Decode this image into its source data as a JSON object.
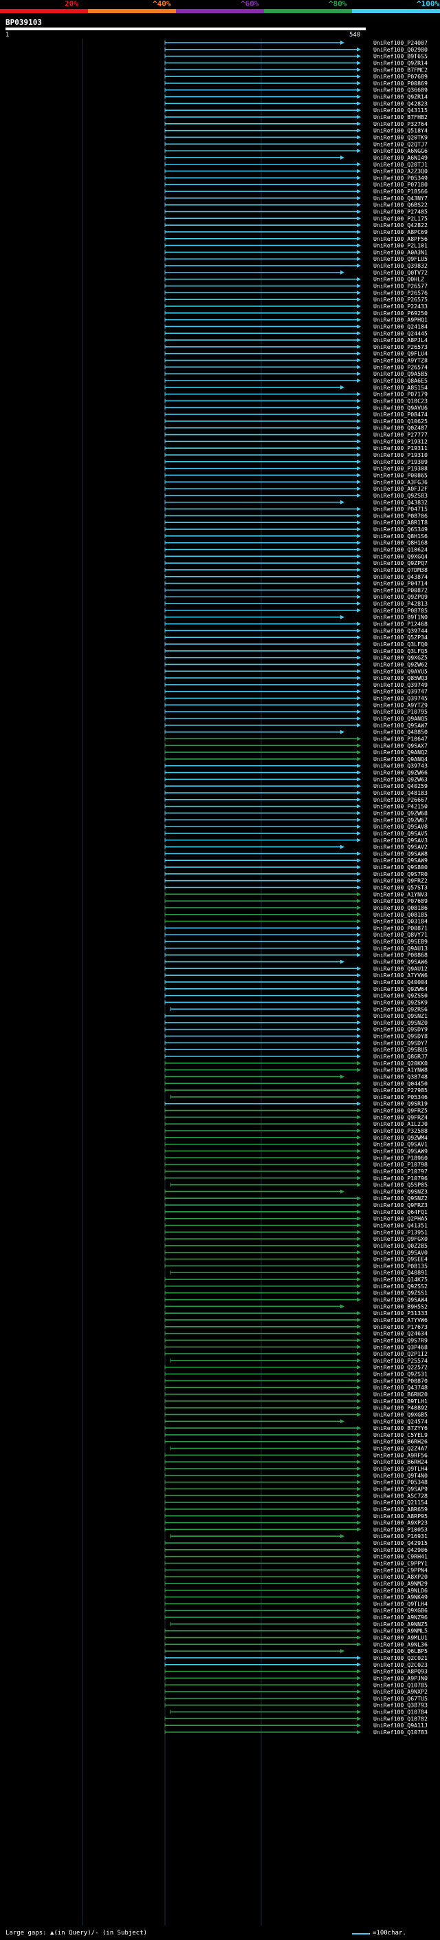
{
  "legend": {
    "labels": [
      "20%",
      "^40%",
      "^60%",
      "^80%",
      "^100%"
    ],
    "colors": [
      "#e8141c",
      "#f47a20",
      "#8a2cb0",
      "#2aa04a",
      "#44ccee"
    ]
  },
  "query": {
    "id": "BP039103",
    "start": "1",
    "end": "540"
  },
  "footer": {
    "large_gaps": "Large gaps: ▲(in Query)/- (in Subject)",
    "scale": "=100char."
  },
  "hits": [
    {
      "label": "UniRef100_P24007",
      "c": "#44ccee"
    },
    {
      "label": "UniRef100_Q02980",
      "c": "#44ccee"
    },
    {
      "label": "UniRef100_B9T6S5",
      "c": "#44ccee"
    },
    {
      "label": "UniRef100_Q9ZR14",
      "c": "#44ccee"
    },
    {
      "label": "UniRef100_B7FMC2",
      "c": "#44ccee"
    },
    {
      "label": "UniRef100_P07689",
      "c": "#44ccee"
    },
    {
      "label": "UniRef100_P00869",
      "c": "#44ccee"
    },
    {
      "label": "UniRef100_Q36689",
      "c": "#44ccee"
    },
    {
      "label": "UniRef100_Q9ZR14",
      "c": "#44ccee"
    },
    {
      "label": "UniRef100_Q42823",
      "c": "#44ccee"
    },
    {
      "label": "UniRef100_Q43115",
      "c": "#44ccee"
    },
    {
      "label": "UniRef100_B7FHB2",
      "c": "#44ccee"
    },
    {
      "label": "UniRef100_P32764",
      "c": "#44ccee"
    },
    {
      "label": "UniRef100_Q518Y4",
      "c": "#44ccee"
    },
    {
      "label": "UniRef100_Q20TK9",
      "c": "#44ccee"
    },
    {
      "label": "UniRef100_Q2QTJ7",
      "c": "#44ccee"
    },
    {
      "label": "UniRef100_A6NGG6",
      "c": "#44ccee"
    },
    {
      "label": "UniRef100_A6NI49",
      "c": "#44ccee"
    },
    {
      "label": "UniRef100_Q20TJ1",
      "c": "#44ccee"
    },
    {
      "label": "UniRef100_A2Z3Q0",
      "c": "#44ccee"
    },
    {
      "label": "UniRef100_P05349",
      "c": "#44ccee"
    },
    {
      "label": "UniRef100_P07180",
      "c": "#44ccee"
    },
    {
      "label": "UniRef100_P18566",
      "c": "#44ccee"
    },
    {
      "label": "UniRef100_Q43NY7",
      "c": "#44ccee"
    },
    {
      "label": "UniRef100_Q6BS22",
      "c": "#44ccee"
    },
    {
      "label": "UniRef100_P27485",
      "c": "#44ccee"
    },
    {
      "label": "UniRef100_P2L175",
      "c": "#44ccee"
    },
    {
      "label": "UniRef100_Q42822",
      "c": "#44ccee"
    },
    {
      "label": "UniRef100_A8PC69",
      "c": "#44ccee"
    },
    {
      "label": "UniRef100_A8PF56",
      "c": "#44ccee"
    },
    {
      "label": "UniRef100_P2L101",
      "c": "#44ccee"
    },
    {
      "label": "UniRef100_A0A3N1",
      "c": "#44ccee"
    },
    {
      "label": "UniRef100_Q9FLU5",
      "c": "#44ccee"
    },
    {
      "label": "UniRef100_Q39832",
      "c": "#44ccee"
    },
    {
      "label": "UniRef100_Q0TV72",
      "c": "#44ccee"
    },
    {
      "label": "UniRef100_Q0HLZ",
      "c": "#44ccee"
    },
    {
      "label": "UniRef100_P26577",
      "c": "#44ccee"
    },
    {
      "label": "UniRef100_P26576",
      "c": "#44ccee"
    },
    {
      "label": "UniRef100_P26575",
      "c": "#44ccee"
    },
    {
      "label": "UniRef100_P22433",
      "c": "#44ccee"
    },
    {
      "label": "UniRef100_P69250",
      "c": "#44ccee"
    },
    {
      "label": "UniRef100_A9PHQ1",
      "c": "#44ccee"
    },
    {
      "label": "UniRef100_Q24184",
      "c": "#44ccee"
    },
    {
      "label": "UniRef100_Q24445",
      "c": "#44ccee"
    },
    {
      "label": "UniRef100_A8PJL4",
      "c": "#44ccee"
    },
    {
      "label": "UniRef100_P26573",
      "c": "#44ccee"
    },
    {
      "label": "UniRef100_Q9FLU4",
      "c": "#44ccee"
    },
    {
      "label": "UniRef100_A9YTZ8",
      "c": "#44ccee"
    },
    {
      "label": "UniRef100_P26574",
      "c": "#44ccee"
    },
    {
      "label": "UniRef100_Q9A5B5",
      "c": "#44ccee"
    },
    {
      "label": "UniRef100_Q8A6E5",
      "c": "#44ccee"
    },
    {
      "label": "UniRef100_A8S1S4",
      "c": "#44ccee"
    },
    {
      "label": "UniRef100_P07179",
      "c": "#44ccee"
    },
    {
      "label": "UniRef100_Q10C23",
      "c": "#44ccee"
    },
    {
      "label": "UniRef100_Q9AVU6",
      "c": "#44ccee"
    },
    {
      "label": "UniRef100_P08474",
      "c": "#44ccee"
    },
    {
      "label": "UniRef100_Q10625",
      "c": "#44ccee"
    },
    {
      "label": "UniRef100_Q0Z487",
      "c": "#44ccee"
    },
    {
      "label": "UniRef100_P27777",
      "c": "#44ccee"
    },
    {
      "label": "UniRef100_P19312",
      "c": "#44ccee"
    },
    {
      "label": "UniRef100_P19311",
      "c": "#44ccee"
    },
    {
      "label": "UniRef100_P19310",
      "c": "#44ccee"
    },
    {
      "label": "UniRef100_P19309",
      "c": "#44ccee"
    },
    {
      "label": "UniRef100_P19308",
      "c": "#44ccee"
    },
    {
      "label": "UniRef100_P00865",
      "c": "#44ccee"
    },
    {
      "label": "UniRef100_A3FGJ6",
      "c": "#44ccee"
    },
    {
      "label": "UniRef100_A0FJ2F",
      "c": "#44ccee"
    },
    {
      "label": "UniRef100_Q9ZS83",
      "c": "#44ccee"
    },
    {
      "label": "UniRef100_Q43832",
      "c": "#44ccee"
    },
    {
      "label": "UniRef100_P04715",
      "c": "#44ccee"
    },
    {
      "label": "UniRef100_P08706",
      "c": "#44ccee"
    },
    {
      "label": "UniRef100_A8R1T8",
      "c": "#44ccee"
    },
    {
      "label": "UniRef100_Q65349",
      "c": "#44ccee"
    },
    {
      "label": "UniRef100_Q8H1S6",
      "c": "#44ccee"
    },
    {
      "label": "UniRef100_Q8H168",
      "c": "#44ccee"
    },
    {
      "label": "UniRef100_Q10624",
      "c": "#44ccee"
    },
    {
      "label": "UniRef100_Q9XGQ4",
      "c": "#44ccee"
    },
    {
      "label": "UniRef100_Q9ZPQ7",
      "c": "#44ccee"
    },
    {
      "label": "UniRef100_Q7DM38",
      "c": "#44ccee"
    },
    {
      "label": "UniRef100_Q43874",
      "c": "#44ccee"
    },
    {
      "label": "UniRef100_P04714",
      "c": "#44ccee"
    },
    {
      "label": "UniRef100_P00872",
      "c": "#44ccee"
    },
    {
      "label": "UniRef100_Q9ZPQ9",
      "c": "#44ccee"
    },
    {
      "label": "UniRef100_P42813",
      "c": "#44ccee"
    },
    {
      "label": "UniRef100_P08705",
      "c": "#44ccee"
    },
    {
      "label": "UniRef100_B9T1N0",
      "c": "#44ccee"
    },
    {
      "label": "UniRef100_P12468",
      "c": "#44ccee"
    },
    {
      "label": "UniRef100_Q39744",
      "c": "#44ccee"
    },
    {
      "label": "UniRef100_Q5ZP34",
      "c": "#44ccee"
    },
    {
      "label": "UniRef100_Q3LFQ0",
      "c": "#44ccee"
    },
    {
      "label": "UniRef100_Q3LFQ5",
      "c": "#44ccee"
    },
    {
      "label": "UniRef100_Q9XGZ5",
      "c": "#44ccee"
    },
    {
      "label": "UniRef100_Q9ZW62",
      "c": "#44ccee"
    },
    {
      "label": "UniRef100_Q9AVU5",
      "c": "#44ccee"
    },
    {
      "label": "UniRef100_Q85WQ3",
      "c": "#44ccee"
    },
    {
      "label": "UniRef100_Q39749",
      "c": "#44ccee"
    },
    {
      "label": "UniRef100_Q39747",
      "c": "#44ccee"
    },
    {
      "label": "UniRef100_Q39745",
      "c": "#44ccee"
    },
    {
      "label": "UniRef100_A9YTZ9",
      "c": "#44ccee"
    },
    {
      "label": "UniRef100_P10795",
      "c": "#44ccee"
    },
    {
      "label": "UniRef100_Q9ANQ5",
      "c": "#44ccee"
    },
    {
      "label": "UniRef100_Q9SAW7",
      "c": "#44ccee"
    },
    {
      "label": "UniRef100_Q48850",
      "c": "#44ccee"
    },
    {
      "label": "UniRef100_P10647",
      "c": "#2aa04a"
    },
    {
      "label": "UniRef100_Q9SAX7",
      "c": "#2aa04a"
    },
    {
      "label": "UniRef100_Q9ANQ2",
      "c": "#2aa04a"
    },
    {
      "label": "UniRef100_Q9ANQ4",
      "c": "#2aa04a"
    },
    {
      "label": "UniRef100_Q39743",
      "c": "#44ccee"
    },
    {
      "label": "UniRef100_Q9ZW66",
      "c": "#44ccee"
    },
    {
      "label": "UniRef100_Q9ZW63",
      "c": "#44ccee"
    },
    {
      "label": "UniRef100_Q40259",
      "c": "#44ccee"
    },
    {
      "label": "UniRef100_Q48183",
      "c": "#44ccee"
    },
    {
      "label": "UniRef100_P26667",
      "c": "#44ccee"
    },
    {
      "label": "UniRef100_P42150",
      "c": "#44ccee"
    },
    {
      "label": "UniRef100_Q9ZW68",
      "c": "#44ccee"
    },
    {
      "label": "UniRef100_Q9ZW67",
      "c": "#44ccee"
    },
    {
      "label": "UniRef100_Q9SAV8",
      "c": "#44ccee"
    },
    {
      "label": "UniRef100_Q9SAV5",
      "c": "#44ccee"
    },
    {
      "label": "UniRef100_Q9SAV3",
      "c": "#44ccee"
    },
    {
      "label": "UniRef100_Q9SAV2",
      "c": "#44ccee"
    },
    {
      "label": "UniRef100_Q9SAW8",
      "c": "#44ccee"
    },
    {
      "label": "UniRef100_Q9SAW9",
      "c": "#44ccee"
    },
    {
      "label": "UniRef100_Q9S800",
      "c": "#44ccee"
    },
    {
      "label": "UniRef100_Q9S7R0",
      "c": "#44ccee"
    },
    {
      "label": "UniRef100_Q9FRZ2",
      "c": "#44ccee"
    },
    {
      "label": "UniRef100_Q57ST3",
      "c": "#44ccee"
    },
    {
      "label": "UniRef100_A1YNV3",
      "c": "#2aa04a"
    },
    {
      "label": "UniRef100_P07689",
      "c": "#2aa04a"
    },
    {
      "label": "UniRef100_Q08186",
      "c": "#2aa04a"
    },
    {
      "label": "UniRef100_Q08185",
      "c": "#2aa04a"
    },
    {
      "label": "UniRef100_Q03184",
      "c": "#2aa04a"
    },
    {
      "label": "UniRef100_P00871",
      "c": "#44ccee"
    },
    {
      "label": "UniRef100_Q8VY71",
      "c": "#44ccee"
    },
    {
      "label": "UniRef100_Q9SEB9",
      "c": "#44ccee"
    },
    {
      "label": "UniRef100_Q9AU13",
      "c": "#44ccee"
    },
    {
      "label": "UniRef100_P00868",
      "c": "#44ccee"
    },
    {
      "label": "UniRef100_Q9SAW6",
      "c": "#44ccee"
    },
    {
      "label": "UniRef100_Q9AU12",
      "c": "#44ccee"
    },
    {
      "label": "UniRef100_A7YVW6",
      "c": "#44ccee"
    },
    {
      "label": "UniRef100_Q40004",
      "c": "#44ccee"
    },
    {
      "label": "UniRef100_Q9ZW64",
      "c": "#44ccee"
    },
    {
      "label": "UniRef100_Q9ZSS0",
      "c": "#44ccee"
    },
    {
      "label": "UniRef100_Q9ZSK9",
      "c": "#44ccee"
    },
    {
      "label": "UniRef100_Q9ZRS6",
      "c": "#44ccee"
    },
    {
      "label": "UniRef100_Q9SNZ1",
      "c": "#44ccee"
    },
    {
      "label": "UniRef100_Q9SNZ0",
      "c": "#44ccee"
    },
    {
      "label": "UniRef100_Q9SDY9",
      "c": "#44ccee"
    },
    {
      "label": "UniRef100_Q9SDY8",
      "c": "#44ccee"
    },
    {
      "label": "UniRef100_Q9SDY7",
      "c": "#44ccee"
    },
    {
      "label": "UniRef100_Q9SBU5",
      "c": "#44ccee"
    },
    {
      "label": "UniRef100_Q8GRJ7",
      "c": "#44ccee"
    },
    {
      "label": "UniRef100_Q20KK0",
      "c": "#2aa04a"
    },
    {
      "label": "UniRef100_A1YNW8",
      "c": "#2aa04a"
    },
    {
      "label": "UniRef100_Q38748",
      "c": "#2aa04a"
    },
    {
      "label": "UniRef100_Q04450",
      "c": "#2aa04a"
    },
    {
      "label": "UniRef100_P27985",
      "c": "#2aa04a"
    },
    {
      "label": "UniRef100_P05346",
      "c": "#2aa04a"
    },
    {
      "label": "UniRef100_Q9SR19",
      "c": "#44ccee"
    },
    {
      "label": "UniRef100_Q9FRZ5",
      "c": "#2aa04a"
    },
    {
      "label": "UniRef100_Q9FRZ4",
      "c": "#2aa04a"
    },
    {
      "label": "UniRef100_A1L2J0",
      "c": "#2aa04a"
    },
    {
      "label": "UniRef100_P32588",
      "c": "#2aa04a"
    },
    {
      "label": "UniRef100_Q9ZWM4",
      "c": "#2aa04a"
    },
    {
      "label": "UniRef100_Q9SAV1",
      "c": "#2aa04a"
    },
    {
      "label": "UniRef100_Q9SAW9",
      "c": "#2aa04a"
    },
    {
      "label": "UniRef100_P18960",
      "c": "#2aa04a"
    },
    {
      "label": "UniRef100_P10798",
      "c": "#2aa04a"
    },
    {
      "label": "UniRef100_P10797",
      "c": "#2aa04a"
    },
    {
      "label": "UniRef100_P10796",
      "c": "#2aa04a"
    },
    {
      "label": "UniRef100_Q5SP05",
      "c": "#2aa04a"
    },
    {
      "label": "UniRef100_Q9SNZ3",
      "c": "#2aa04a"
    },
    {
      "label": "UniRef100_Q9SNZ2",
      "c": "#2aa04a"
    },
    {
      "label": "UniRef100_Q9FRZ3",
      "c": "#2aa04a"
    },
    {
      "label": "UniRef100_Q64FQ1",
      "c": "#2aa04a"
    },
    {
      "label": "UniRef100_Q2PHA5",
      "c": "#2aa04a"
    },
    {
      "label": "UniRef100_Q41351",
      "c": "#2aa04a"
    },
    {
      "label": "UniRef100_P13951",
      "c": "#2aa04a"
    },
    {
      "label": "UniRef100_Q9FGX0",
      "c": "#2aa04a"
    },
    {
      "label": "UniRef100_Q0Z2B5",
      "c": "#2aa04a"
    },
    {
      "label": "UniRef100_Q9SAV0",
      "c": "#2aa04a"
    },
    {
      "label": "UniRef100_Q9SEE4",
      "c": "#2aa04a"
    },
    {
      "label": "UniRef100_P08135",
      "c": "#2aa04a"
    },
    {
      "label": "UniRef100_Q40891",
      "c": "#2aa04a"
    },
    {
      "label": "UniRef100_Q14K75",
      "c": "#2aa04a"
    },
    {
      "label": "UniRef100_Q9ZSS2",
      "c": "#2aa04a"
    },
    {
      "label": "UniRef100_Q9ZSS1",
      "c": "#2aa04a"
    },
    {
      "label": "UniRef100_Q9SAW4",
      "c": "#2aa04a"
    },
    {
      "label": "UniRef100_B9H5S2",
      "c": "#2aa04a"
    },
    {
      "label": "UniRef100_P31333",
      "c": "#2aa04a"
    },
    {
      "label": "UniRef100_A7YVW6",
      "c": "#2aa04a"
    },
    {
      "label": "UniRef100_P17673",
      "c": "#2aa04a"
    },
    {
      "label": "UniRef100_Q24634",
      "c": "#2aa04a"
    },
    {
      "label": "UniRef100_Q9S7R9",
      "c": "#2aa04a"
    },
    {
      "label": "UniRef100_Q3P468",
      "c": "#2aa04a"
    },
    {
      "label": "UniRef100_Q2P1I2",
      "c": "#2aa04a"
    },
    {
      "label": "UniRef100_P25574",
      "c": "#2aa04a"
    },
    {
      "label": "UniRef100_Q22572",
      "c": "#2aa04a"
    },
    {
      "label": "UniRef100_Q9ZS31",
      "c": "#2aa04a"
    },
    {
      "label": "UniRef100_P00870",
      "c": "#2aa04a"
    },
    {
      "label": "UniRef100_Q43748",
      "c": "#2aa04a"
    },
    {
      "label": "UniRef100_B6RH20",
      "c": "#2aa04a"
    },
    {
      "label": "UniRef100_B9TLH1",
      "c": "#2aa04a"
    },
    {
      "label": "UniRef100_P40892",
      "c": "#2aa04a"
    },
    {
      "label": "UniRef100_Q9XGB5",
      "c": "#2aa04a"
    },
    {
      "label": "UniRef100_Q24574",
      "c": "#2aa04a"
    },
    {
      "label": "UniRef100_B7ZYY6",
      "c": "#2aa04a"
    },
    {
      "label": "UniRef100_C5YEL9",
      "c": "#2aa04a"
    },
    {
      "label": "UniRef100_B6RH26",
      "c": "#2aa04a"
    },
    {
      "label": "UniRef100_Q2Z4A7",
      "c": "#2aa04a"
    },
    {
      "label": "UniRef100_A9RF56",
      "c": "#2aa04a"
    },
    {
      "label": "UniRef100_B6RH24",
      "c": "#2aa04a"
    },
    {
      "label": "UniRef100_Q9TLH4",
      "c": "#2aa04a"
    },
    {
      "label": "UniRef100_Q9T4N0",
      "c": "#2aa04a"
    },
    {
      "label": "UniRef100_P05348",
      "c": "#2aa04a"
    },
    {
      "label": "UniRef100_Q9SAP9",
      "c": "#2aa04a"
    },
    {
      "label": "UniRef100_A5C728",
      "c": "#2aa04a"
    },
    {
      "label": "UniRef100_Q21154",
      "c": "#2aa04a"
    },
    {
      "label": "UniRef100_A8R659",
      "c": "#2aa04a"
    },
    {
      "label": "UniRef100_A8RP95",
      "c": "#2aa04a"
    },
    {
      "label": "UniRef100_A9XP23",
      "c": "#2aa04a"
    },
    {
      "label": "UniRef100_P10053",
      "c": "#2aa04a"
    },
    {
      "label": "UniRef100_P16931",
      "c": "#2aa04a"
    },
    {
      "label": "UniRef100_Q42915",
      "c": "#2aa04a"
    },
    {
      "label": "UniRef100_Q42906",
      "c": "#2aa04a"
    },
    {
      "label": "UniRef100_C9RH41",
      "c": "#2aa04a"
    },
    {
      "label": "UniRef100_C9PPY1",
      "c": "#2aa04a"
    },
    {
      "label": "UniRef100_C9PPN4",
      "c": "#2aa04a"
    },
    {
      "label": "UniRef100_A8XP20",
      "c": "#2aa04a"
    },
    {
      "label": "UniRef100_A9NM29",
      "c": "#2aa04a"
    },
    {
      "label": "UniRef100_A9NLD6",
      "c": "#2aa04a"
    },
    {
      "label": "UniRef100_A9NK49",
      "c": "#2aa04a"
    },
    {
      "label": "UniRef100_Q9TLH4",
      "c": "#2aa04a"
    },
    {
      "label": "UniRef100_Q9XGB6",
      "c": "#2aa04a"
    },
    {
      "label": "UniRef100_A9NZ96",
      "c": "#2aa04a"
    },
    {
      "label": "UniRef100_A9NNZ5",
      "c": "#2aa04a"
    },
    {
      "label": "UniRef100_A9NML5",
      "c": "#2aa04a"
    },
    {
      "label": "UniRef100_A9MLU1",
      "c": "#2aa04a"
    },
    {
      "label": "UniRef100_A9NL36",
      "c": "#2aa04a"
    },
    {
      "label": "UniRef100_Q6LBP5",
      "c": "#2aa04a"
    },
    {
      "label": "UniRef100_Q2C021",
      "c": "#44ccee"
    },
    {
      "label": "UniRef100_Q2C023",
      "c": "#44ccee"
    },
    {
      "label": "UniRef100_A8PQ93",
      "c": "#2aa04a"
    },
    {
      "label": "UniRef100_A9PJN0",
      "c": "#2aa04a"
    },
    {
      "label": "UniRef100_Q10785",
      "c": "#2aa04a"
    },
    {
      "label": "UniRef100_A9NXP2",
      "c": "#2aa04a"
    },
    {
      "label": "UniRef100_Q67TU5",
      "c": "#2aa04a"
    },
    {
      "label": "UniRef100_Q38793",
      "c": "#2aa04a"
    },
    {
      "label": "UniRef100_Q10784",
      "c": "#2aa04a"
    },
    {
      "label": "UniRef100_Q10782",
      "c": "#2aa04a"
    },
    {
      "label": "UniRef100_Q9A11J",
      "c": "#2aa04a"
    },
    {
      "label": "UniRef100_Q10783",
      "c": "#2aa04a"
    }
  ]
}
